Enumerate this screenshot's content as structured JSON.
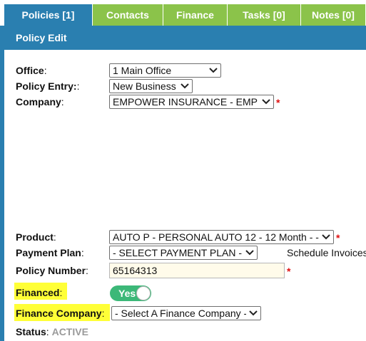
{
  "tabs": [
    {
      "label": "Policies [1]",
      "active": true
    },
    {
      "label": "Contacts",
      "active": false
    },
    {
      "label": "Finance",
      "active": false
    },
    {
      "label": "Tasks [0]",
      "active": false
    },
    {
      "label": "Notes [0]",
      "active": false
    }
  ],
  "panel": {
    "title": "Policy Edit"
  },
  "form": {
    "office": {
      "label": "Office",
      "suffix": ":",
      "value": "1 Main Office"
    },
    "policy_entry": {
      "label": "Policy Entry:",
      "suffix": ":",
      "value": "New Business"
    },
    "company": {
      "label": "Company",
      "suffix": ":",
      "value": "EMPOWER INSURANCE - EMP",
      "required": "*"
    },
    "product": {
      "label": "Product",
      "suffix": ":",
      "value": "AUTO P - PERSONAL AUTO 12 - 12 Month - -",
      "required": "*"
    },
    "payment_plan": {
      "label": "Payment Plan",
      "suffix": ":",
      "value": "- SELECT PAYMENT PLAN -",
      "side_text": "Schedule Invoices"
    },
    "policy_number": {
      "label": "Policy Number",
      "suffix": ":",
      "value": "65164313",
      "required": "*"
    },
    "financed": {
      "label": "Financed",
      "suffix": ":",
      "toggle_label": "Yes"
    },
    "finance_company": {
      "label": "Finance Company",
      "suffix": ":",
      "value": "- Select A Finance Company -"
    },
    "status": {
      "label": "Status",
      "suffix": ":",
      "value": "ACTIVE"
    }
  },
  "colors": {
    "tab_active": "#2a7fb0",
    "tab_inactive": "#8bc34a",
    "highlight": "#ffff37",
    "toggle_on": "#3cb878",
    "required": "#e01010"
  },
  "icons": {
    "select_arrow": "chevron-down-icon",
    "toggle_knob": "toggle-knob"
  }
}
